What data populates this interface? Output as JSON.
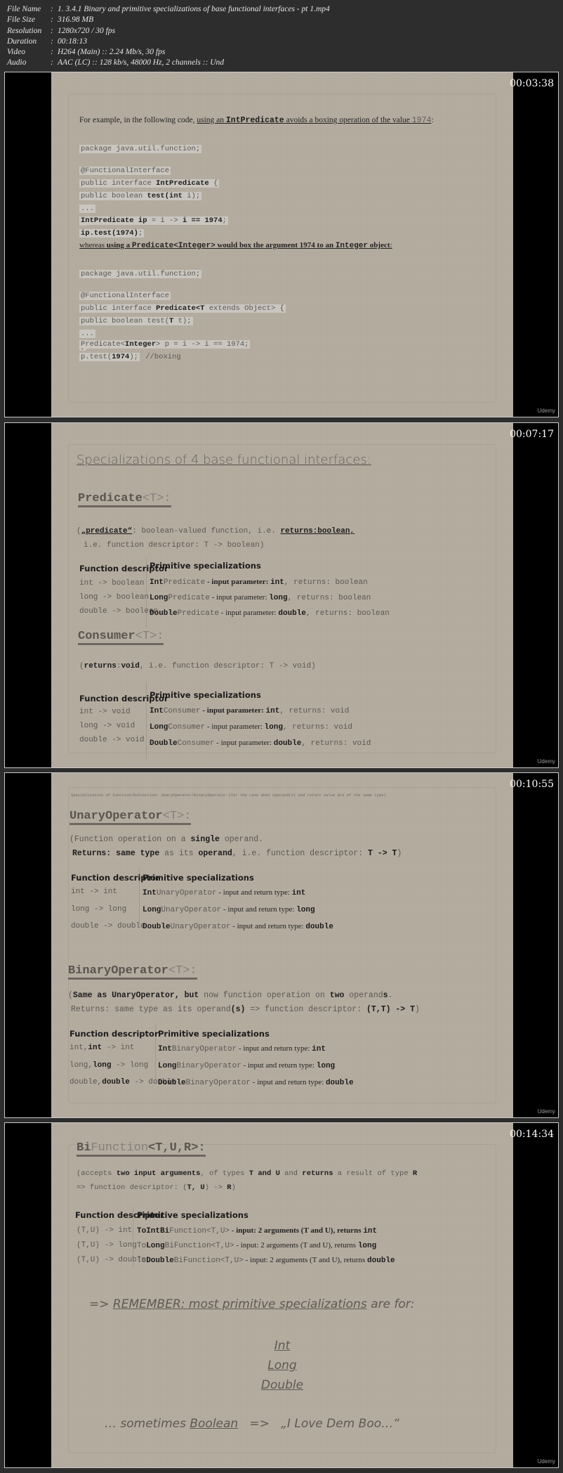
{
  "file_info": {
    "rows": [
      {
        "key": "File Name",
        "value": "1. 3.4.1 Binary and primitive specializations of base functional interfaces - pt 1.mp4"
      },
      {
        "key": "File Size",
        "value": "316.98 MB"
      },
      {
        "key": "Resolution",
        "value": "1280x720 / 30 fps"
      },
      {
        "key": "Duration",
        "value": "00:18:13"
      },
      {
        "key": "Video",
        "value": "H264 (Main) :: 2.24 Mb/s, 30 fps"
      },
      {
        "key": "Audio",
        "value": "AAC (LC) :: 128 kb/s, 48000 Hz, 2 channels :: Und"
      }
    ]
  },
  "watermark": "Udemy",
  "frames": [
    {
      "timestamp": "00:03:38",
      "intro": {
        "pre": "For example, in the following code, ",
        "u1": "using an ",
        "code": "IntPredicate",
        "u2": " avoids a boxing operation of the value ",
        "num": "1974",
        "end": ":"
      },
      "code1": [
        "package java.util.function;",
        "",
        "@FunctionalInterface",
        "public interface IntPredicate {",
        "    public boolean test(int i);",
        "    ...",
        "}"
      ],
      "code2": [
        "IntPredicate ip = i -> i == 1974;",
        "ip.test(1974);"
      ],
      "whereas": {
        "w": "whereas ",
        "b1": "using a ",
        "c1": "Predicate<Integer>",
        "b2": " would box the argument 1974 to an ",
        "c2": "Integer",
        "b3": " object",
        "end": ":"
      },
      "code3": [
        "package java.util.function;",
        "",
        "@FunctionalInterface",
        "public interface Predicate<T extends Object> {",
        "    public boolean test(T t);",
        "    ...",
        "}"
      ],
      "code4": [
        "Predicate<Integer> p = i -> i == 1974;",
        "p.test(1974); //boxing"
      ]
    },
    {
      "timestamp": "00:07:17",
      "title": "Specializations of 4 base functional interfaces:",
      "predicate": {
        "heading": "Predicate",
        "generic": "<T>:",
        "desc1": {
          "a": "(",
          "q": "„predicate“",
          "b": ": boolean-valued function, i.e. ",
          "r": "returns:boolean,"
        },
        "desc2": "i.e. function descriptor: T -> boolean)",
        "col1": "Function descriptor",
        "col2": "Primitive specializations",
        "rows": [
          {
            "fd": "int -> boolean",
            "pre": "Int",
            "name": "Predicate",
            "mid": " - input parameter: ",
            "type": "int",
            "ret": ",  returns: boolean"
          },
          {
            "fd": "long -> boolean",
            "pre": "Long",
            "name": "Predicate",
            "mid": " - input parameter: ",
            "type": "long",
            "ret": ",  returns: boolean"
          },
          {
            "fd": "double -> boolean",
            "pre": "Double",
            "name": "Predicate",
            "mid": "  - input parameter: ",
            "type": "double",
            "ret": ",  returns: boolean"
          }
        ]
      },
      "consumer": {
        "heading": "Consumer",
        "generic": "<T>:",
        "desc": {
          "a": "(",
          "r": "returns",
          "c": ":",
          "v": "void",
          "b": ", i.e. function descriptor: T -> void)"
        },
        "col1": "Function descriptor",
        "col2": "Primitive specializations",
        "rows": [
          {
            "fd": "int -> void",
            "pre": "Int",
            "name": "Consumer",
            "mid": " - input parameter: ",
            "type": "int",
            "ret": ",  returns: void"
          },
          {
            "fd": "long -> void",
            "pre": "Long",
            "name": "Consumer",
            "mid": " - input parameter: ",
            "type": "long",
            "ret": ",  returns: void"
          },
          {
            "fd": "double -> void",
            "pre": "Double",
            "name": "Consumer",
            "mid": "  - input parameter: ",
            "type": "double",
            "ret": ",  returns: void"
          }
        ]
      }
    },
    {
      "timestamp": "00:10:55",
      "subtitle": "Specialization of Function/BiFunction: UnaryOperator/BinaryOperator (for the case when operand(s) and return value are of the same type)",
      "unary": {
        "heading": "UnaryOperator",
        "generic": "<T>:",
        "l1": {
          "a": "(Function operation on a ",
          "b": "single",
          "c": " operand."
        },
        "l2": {
          "a": "Returns: same type",
          "b": " as its ",
          "c": "operand",
          "d": ", i.e. function descriptor: ",
          "e": "T -> T",
          "f": ")"
        },
        "col1": "Function descriptor",
        "col2": "Primitive specializations",
        "rows": [
          {
            "fd": "int -> int",
            "pre": "Int",
            "name": "UnaryOperator",
            "mid": " - input and return type: ",
            "type": "int"
          },
          {
            "fd": "long -> long",
            "pre": "Long",
            "name": "UnaryOperator",
            "mid": " - input and return type: ",
            "type": "long"
          },
          {
            "fd": "double -> double",
            "pre": "Double",
            "name": "UnaryOperator",
            "mid": " - input and return type: ",
            "type": "double"
          }
        ]
      },
      "binary": {
        "heading": "BinaryOperator",
        "generic": "<T>:",
        "l1": {
          "a": "(",
          "b": "Same as UnaryOperator, but",
          "c": " now function operation on ",
          "d": "two",
          "e": " operand",
          "f": "s",
          "g": "."
        },
        "l2": {
          "a": "Returns: same type as its operand",
          "b": "(s)",
          "c": " => function descriptor: ",
          "d": "(T,T) -> T",
          "e": ")"
        },
        "col1": "Function descriptor",
        "col2": "Primitive specializations",
        "rows": [
          {
            "fd1": "int,",
            "fd2": "int",
            "fd3": " -> int",
            "pre": "Int",
            "name": "BinaryOperator",
            "mid": " - input and return type: ",
            "type": "int"
          },
          {
            "fd1": "long,",
            "fd2": "long",
            "fd3": " -> long",
            "pre": "Long",
            "name": "BinaryOperator",
            "mid": " - input and return type: ",
            "type": "long"
          },
          {
            "fd1": "double,",
            "fd2": "double",
            "fd3": " -> double",
            "pre": "Double",
            "name": "BinaryOperator",
            "mid": " - input and return type: ",
            "type": "double"
          }
        ]
      }
    },
    {
      "timestamp": "00:14:34",
      "bifunction": {
        "bi": "Bi",
        "heading": "Function",
        "generic": "<T,U,R>:",
        "l1": {
          "a": "(accepts ",
          "b": "two input arguments",
          "c": ", of types ",
          "d": "T and U",
          "e": " and ",
          "f": "returns",
          "g": " a result of type ",
          "h": "R"
        },
        "l2": {
          "a": "=> function descriptor: (",
          "b": "T, U",
          "c": ") -> ",
          "d": "R",
          "e": ")"
        },
        "col1": "Function descriptor",
        "col2": "Primitive specializations",
        "rows": [
          {
            "fd": "(T,U) -> int",
            "to": "ToIntBi",
            "name": "Function<T,U>",
            "mid": " - input: 2 arguments (T and U),  returns ",
            "type": "int"
          },
          {
            "fd": "(T,U) -> long",
            "to": "To",
            "tob": "Long",
            "bi": "Bi",
            "name": "Function<T,U>",
            "mid": " - input: 2 arguments (T and U),  returns ",
            "type": "long"
          },
          {
            "fd": "(T,U) -> double",
            "to": "To",
            "tob": "Double",
            "bi": "Bi",
            "name": "Function<T,U>",
            "mid": " - input: 2 arguments (T and U), returns ",
            "type": "double"
          }
        ]
      },
      "remember": {
        "arrow": "=> ",
        "label": "REMEMBER:",
        "mid": " most primitive specializations",
        "end": " are for:"
      },
      "types": [
        "Int",
        "Long",
        "Double"
      ],
      "sometimes": {
        "pre": "… sometimes ",
        "boolean": "Boolean",
        "arrow": "   =>   ",
        "quote": "„I Love Dem Boo…“"
      }
    }
  ]
}
